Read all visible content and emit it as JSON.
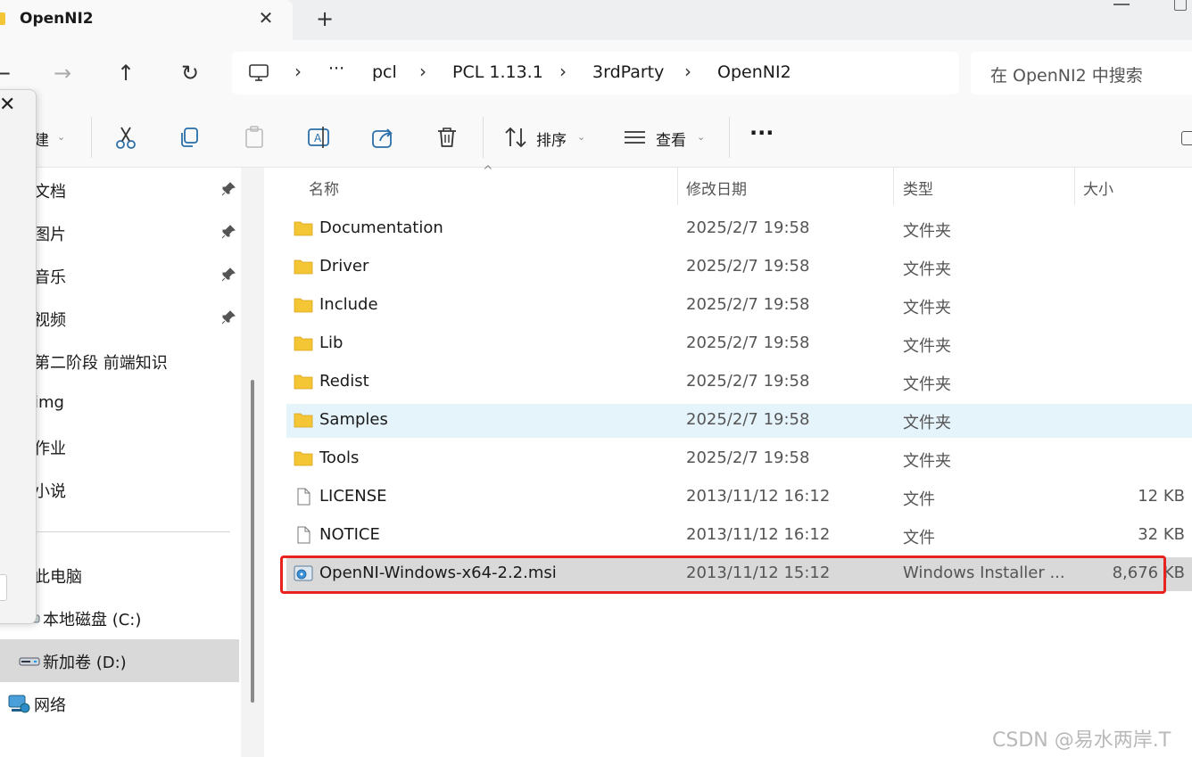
{
  "tab": {
    "title": "OpenNI2",
    "close_glyph": "✕",
    "new_tab_glyph": "+"
  },
  "nav": {
    "back_glyph": "←",
    "forward_glyph": "→",
    "up_glyph": "↑",
    "refresh_glyph": "↻"
  },
  "breadcrumb": {
    "ellipsis": "···",
    "separator": "›",
    "items": [
      "pcl",
      "PCL 1.13.1",
      "3rdParty",
      "OpenNI2"
    ]
  },
  "search": {
    "placeholder": "在 OpenNI2 中搜索"
  },
  "toolbar": {
    "new_label": "建",
    "sort_label": "排序",
    "view_label": "查看",
    "more_label": "···",
    "caret": "⌄"
  },
  "popup": {
    "close_glyph": "✕"
  },
  "sidebar": {
    "quick_access": [
      {
        "label": "文档",
        "pinned": true
      },
      {
        "label": "图片",
        "pinned": true
      },
      {
        "label": "音乐",
        "pinned": true
      },
      {
        "label": "视频",
        "pinned": true
      },
      {
        "label": "第二阶段 前端知识",
        "pinned": false
      },
      {
        "label": "img",
        "pinned": false
      },
      {
        "label": "作业",
        "pinned": false
      },
      {
        "label": "小说",
        "pinned": false
      }
    ],
    "this_pc": "此电脑",
    "drives": [
      "本地磁盘 (C:)",
      "新加卷 (D:)"
    ],
    "network": "网络"
  },
  "columns": {
    "name": "名称",
    "modified": "修改日期",
    "type": "类型",
    "size": "大小"
  },
  "files": [
    {
      "name": "Documentation",
      "modified": "2025/2/7 19:58",
      "type": "文件夹",
      "size": "",
      "icon": "folder-icon"
    },
    {
      "name": "Driver",
      "modified": "2025/2/7 19:58",
      "type": "文件夹",
      "size": "",
      "icon": "folder-icon"
    },
    {
      "name": "Include",
      "modified": "2025/2/7 19:58",
      "type": "文件夹",
      "size": "",
      "icon": "folder-icon"
    },
    {
      "name": "Lib",
      "modified": "2025/2/7 19:58",
      "type": "文件夹",
      "size": "",
      "icon": "folder-icon"
    },
    {
      "name": "Redist",
      "modified": "2025/2/7 19:58",
      "type": "文件夹",
      "size": "",
      "icon": "folder-icon"
    },
    {
      "name": "Samples",
      "modified": "2025/2/7 19:58",
      "type": "文件夹",
      "size": "",
      "icon": "folder-icon"
    },
    {
      "name": "Tools",
      "modified": "2025/2/7 19:58",
      "type": "文件夹",
      "size": "",
      "icon": "folder-icon"
    },
    {
      "name": "LICENSE",
      "modified": "2013/11/12 16:12",
      "type": "文件",
      "size": "12 KB",
      "icon": "file-icon"
    },
    {
      "name": "NOTICE",
      "modified": "2013/11/12 16:12",
      "type": "文件",
      "size": "32 KB",
      "icon": "file-icon"
    },
    {
      "name": "OpenNI-Windows-x64-2.2.msi",
      "modified": "2013/11/12 15:12",
      "type": "Windows Installer ...",
      "size": "8,676 KB",
      "icon": "installer-icon"
    }
  ],
  "watermark": "CSDN @易水两岸.T",
  "colors": {
    "highlight": "#e8231f",
    "folder": "#f4c534",
    "hover_row": "#e5f3fb",
    "selected_row": "#d9d9d9"
  }
}
